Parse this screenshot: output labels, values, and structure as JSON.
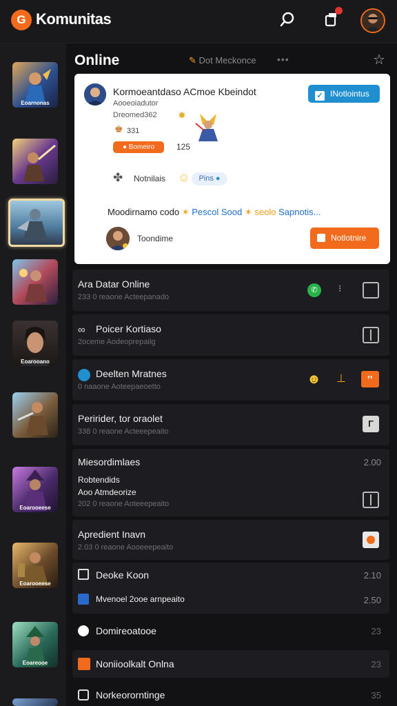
{
  "app": {
    "name": "Komunitas",
    "logo_glyph": "G"
  },
  "header": {
    "title": "Online",
    "tag": "Dot Meckonce",
    "dots": "•••"
  },
  "colors": {
    "accent": "#f26a1b",
    "blue": "#1f8fd0",
    "bg": "#121214",
    "row": "#1d1d21",
    "card": "#ffffff"
  },
  "sidebar": {
    "items": [
      {
        "caption": "Eoarnonas"
      },
      {
        "caption": ""
      },
      {
        "caption": ""
      },
      {
        "caption": ""
      },
      {
        "caption": "Eoarooano"
      },
      {
        "caption": ""
      },
      {
        "caption": "Eoarooeese"
      },
      {
        "caption": "Eoarooeese"
      },
      {
        "caption": "Eoareooe"
      },
      {
        "caption": ""
      }
    ]
  },
  "card": {
    "title": "Kormoeantdaso ACmoe Kbeindot",
    "sub1": "Aooeoiadutor",
    "sub2": "Dreomed362",
    "count1": "331",
    "pill": "Bomeiro",
    "count2": "125",
    "notif_button": "INotlointus",
    "notes_label": "Notnilais",
    "pill_blue": "Pins",
    "line3": {
      "a": "Moodirnamo codo",
      "b": "Pescol Sood",
      "c": "seolo",
      "d": "Sapnotis..."
    },
    "foot_label": "Toondime",
    "cta": "Notlotnire"
  },
  "rows": [
    {
      "title": "Ara Datar Online",
      "sub": "233 0 reaone Acteepanado",
      "right": ""
    },
    {
      "title": "Poicer Kortiaso",
      "sub": "2oceme Aodeoprepailg",
      "right": ""
    },
    {
      "title": "Deelten Mratnes",
      "sub": "0 naaone Aoteepaeoetto",
      "right": ""
    },
    {
      "title": "Peririder, tor oraolet",
      "sub": "338 0 reaone Acteeepeaito",
      "right": ""
    },
    {
      "title": "Miesordimlaes",
      "sub": "",
      "right": "2.00",
      "extra1": "Robtendids",
      "extra2": "Aoo Atmdeorize",
      "extra3": "202 0 reaone Aoteeepeaito"
    },
    {
      "title": "Apredient Inavn",
      "sub": "2.03 0 reaone Aooeeepeaito",
      "right": ""
    },
    {
      "title": "Deoke Koon",
      "sub": "",
      "right": "2.10",
      "sub2": "Mvenoel  2ooe arnpeaito",
      "right2": "2.50"
    },
    {
      "title": "Domireoatooe",
      "sub": "",
      "right": "23"
    },
    {
      "title": "Noniioolkalt Onlna",
      "sub": "",
      "right": "23"
    },
    {
      "title": "Norkeororntinge",
      "sub": "",
      "right": "35"
    }
  ]
}
